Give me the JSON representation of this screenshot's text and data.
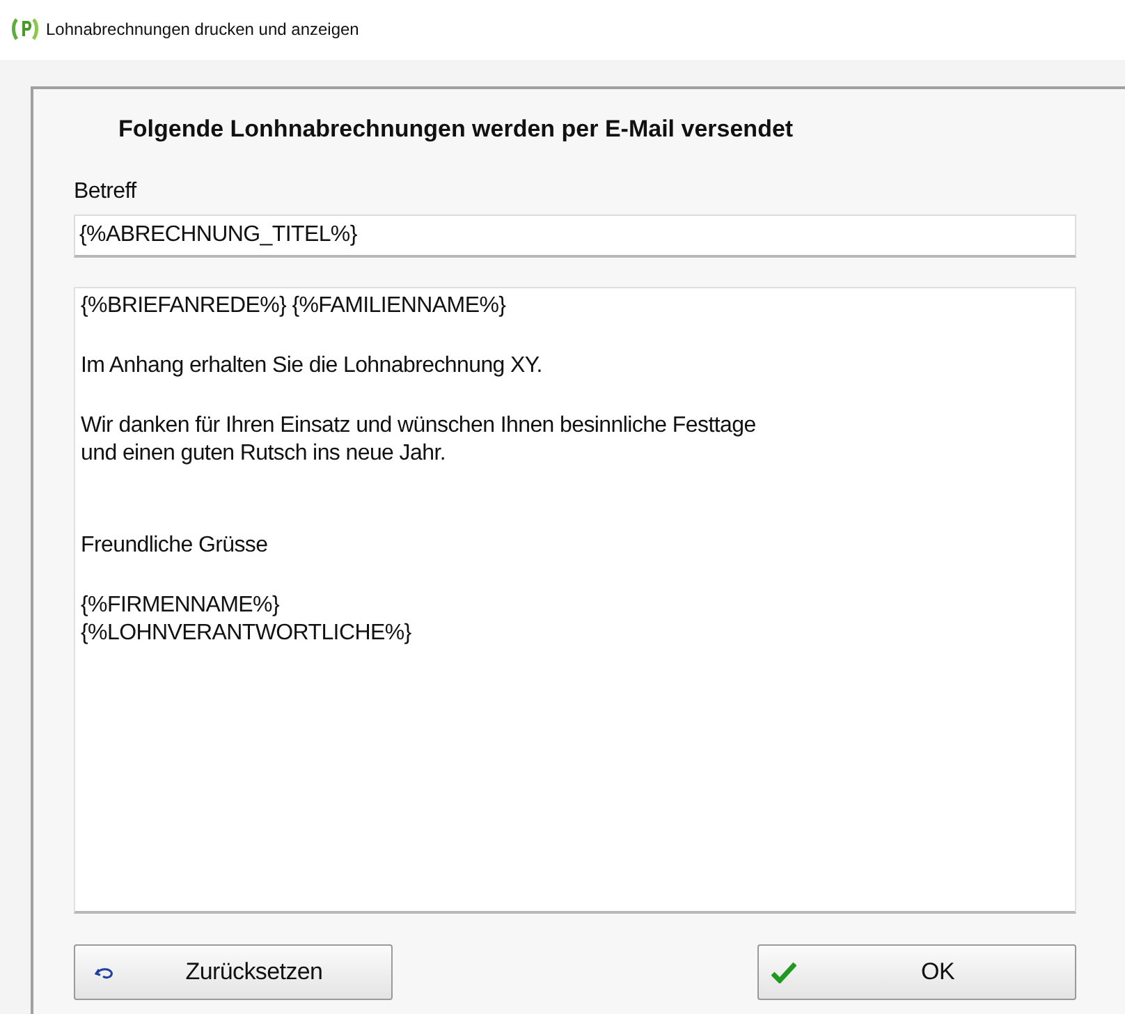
{
  "window": {
    "title": "Lohnabrechnungen drucken und anzeigen"
  },
  "heading": "Folgende Lonhnabrechnungen  werden per E-Mail versendet",
  "subject": {
    "label": "Betreff",
    "value": "{%ABRECHNUNG_TITEL%}"
  },
  "body_lines": [
    {
      "kind": "text",
      "text": "{%BRIEFANREDE%} {%FAMILIENNAME%}"
    },
    {
      "kind": "blank"
    },
    {
      "kind": "text",
      "text": "Im Anhang erhalten Sie die Lohnabrechnung XY."
    },
    {
      "kind": "blank"
    },
    {
      "kind": "text",
      "text": "Wir danken für Ihren Einsatz und wünschen Ihnen besinnliche Festtage"
    },
    {
      "kind": "text",
      "text": "und einen guten Rutsch ins neue Jahr."
    },
    {
      "kind": "blank"
    },
    {
      "kind": "blank"
    },
    {
      "kind": "text",
      "text": "Freundliche Grüsse"
    },
    {
      "kind": "blank"
    },
    {
      "kind": "text",
      "text": "{%FIRMENNAME%}"
    },
    {
      "kind": "text",
      "text": "{%LOHNVERANTWORTLICHE%}"
    }
  ],
  "buttons": [
    {
      "kind": "reset",
      "label": "Zurücksetzen"
    },
    {
      "kind": "ok",
      "label": "OK"
    }
  ]
}
